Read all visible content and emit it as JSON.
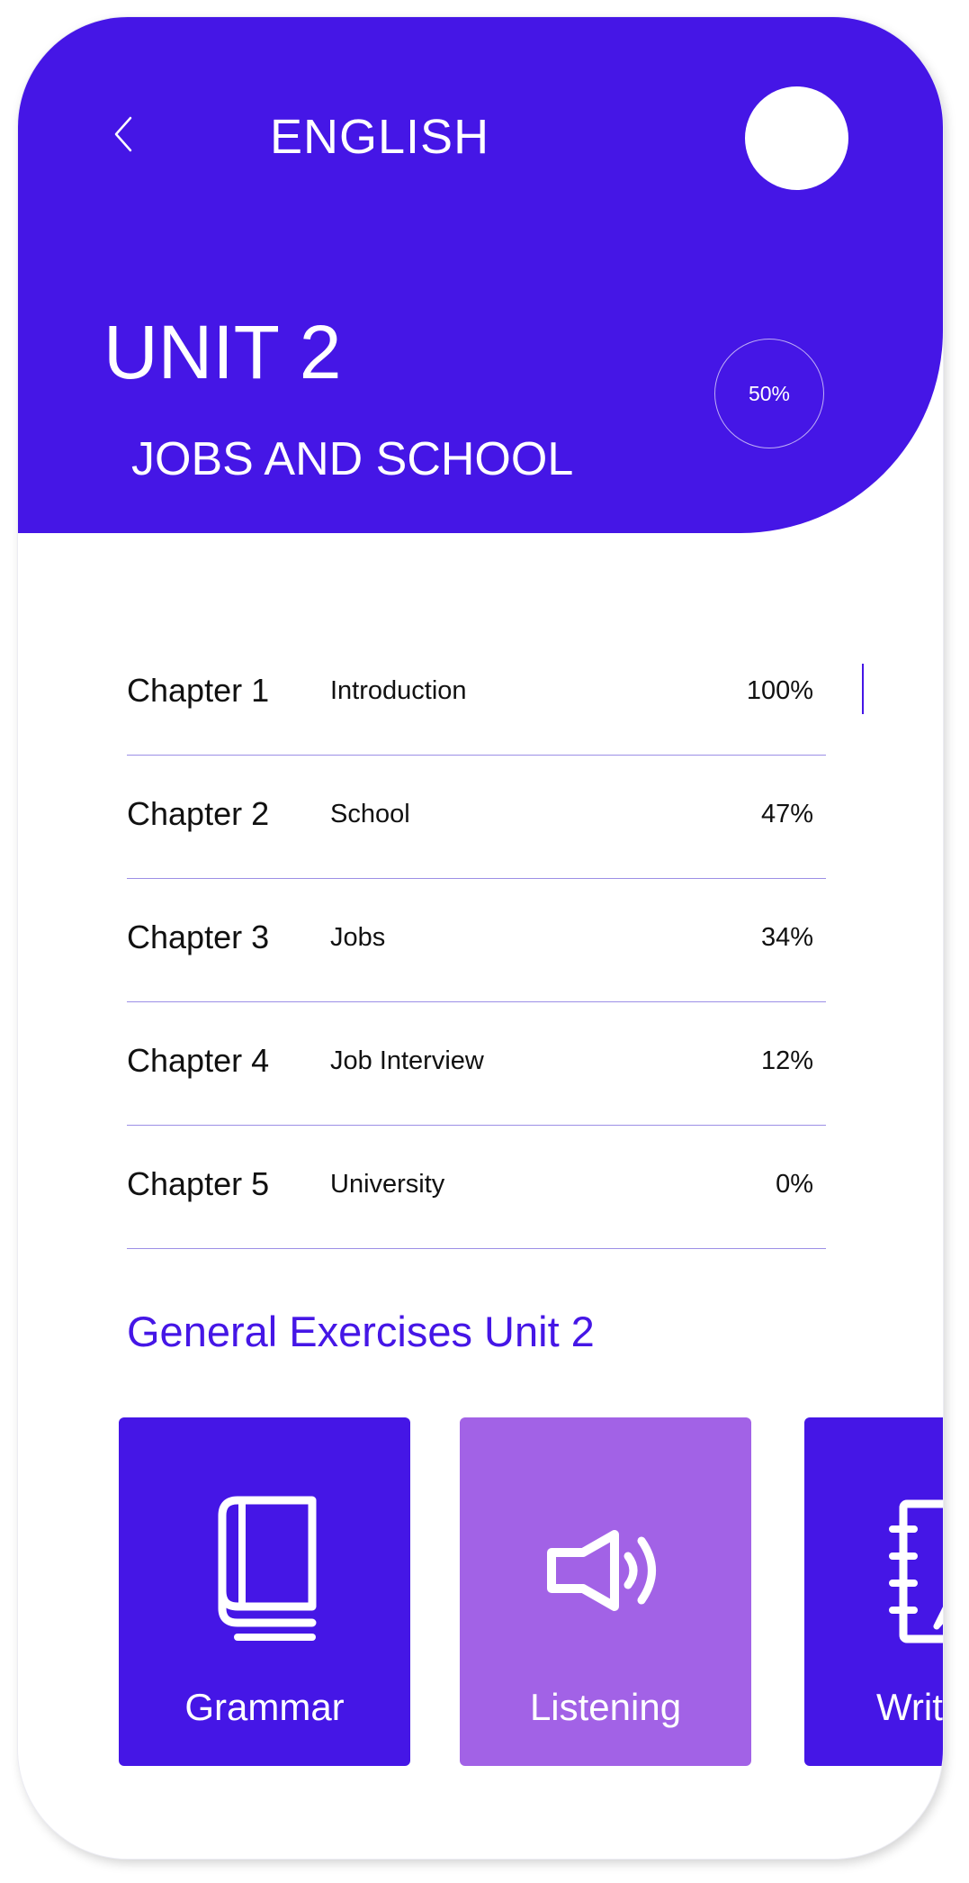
{
  "header": {
    "title": "ENGLISH",
    "unit_title": "UNIT 2",
    "unit_subtitle": "JOBS AND SCHOOL",
    "unit_progress": "50%",
    "background_color": "#4516e6"
  },
  "chapters": [
    {
      "name": "Chapter 1",
      "topic": "Introduction",
      "progress": "100%"
    },
    {
      "name": "Chapter 2",
      "topic": "School",
      "progress": "47%"
    },
    {
      "name": "Chapter 3",
      "topic": "Jobs",
      "progress": "34%"
    },
    {
      "name": "Chapter 4",
      "topic": "Job Interview",
      "progress": "12%"
    },
    {
      "name": "Chapter 5",
      "topic": "University",
      "progress": "0%"
    }
  ],
  "exercises": {
    "title": "General Exercises Unit 2",
    "cards": [
      {
        "label": "Grammar",
        "icon": "book-icon",
        "color": "#4516e6"
      },
      {
        "label": "Listening",
        "icon": "speaker-icon",
        "color": "#a262e6"
      },
      {
        "label": "Writ",
        "icon": "notebook-icon",
        "color": "#4516e6"
      }
    ]
  },
  "icons": {
    "back": "chevron-left-icon",
    "avatar": "avatar"
  }
}
